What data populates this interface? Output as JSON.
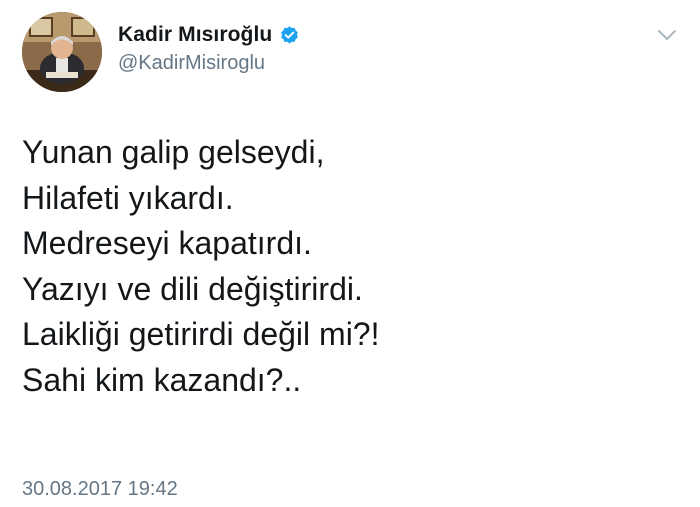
{
  "author": {
    "display_name": "Kadir Mısıroğlu",
    "handle": "@KadirMisiroglu",
    "verified": true,
    "verified_icon": "verified-badge-icon"
  },
  "menu": {
    "icon": "chevron-down-icon"
  },
  "tweet": {
    "lines": [
      "Yunan galip gelseydi,",
      "Hilafeti yıkardı.",
      "Medreseyi kapatırdı.",
      "Yazıyı ve dili değiştirirdi.",
      "Laikliği getirirdi değil mi?!",
      "Sahi kim kazandı?.."
    ],
    "timestamp": "30.08.2017 19:42"
  },
  "colors": {
    "text_primary": "#14171a",
    "text_secondary": "#657786",
    "verified_blue": "#1da1f2",
    "caret_gray": "#aab8c2"
  }
}
